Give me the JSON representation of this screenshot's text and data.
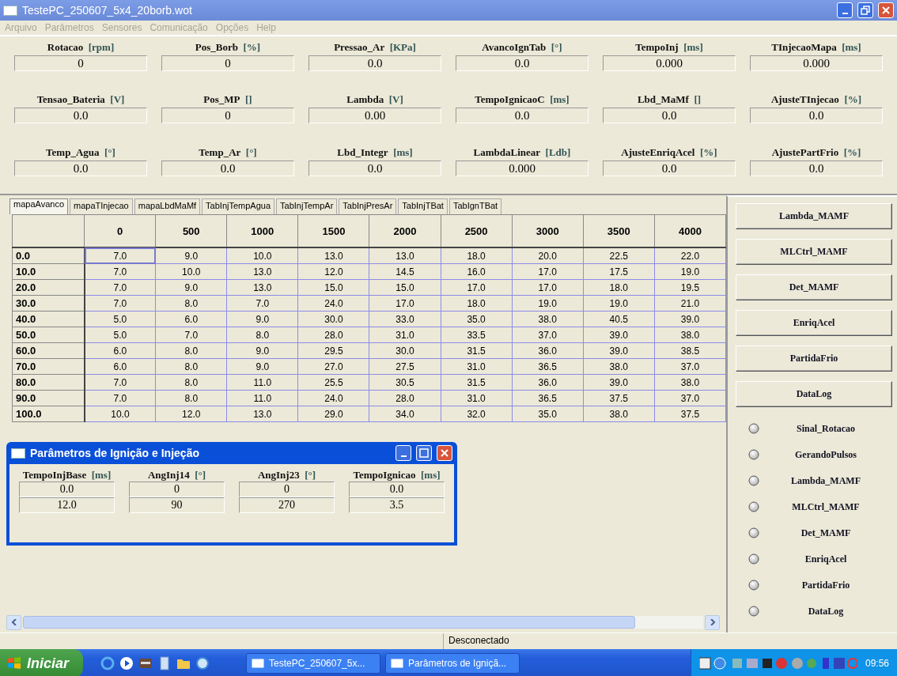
{
  "window": {
    "title": "TestePC_250607_5x4_20borb.wot"
  },
  "menu": [
    {
      "label": "Arquivo",
      "disabled": true
    },
    {
      "label": "Parâmetros",
      "disabled": true
    },
    {
      "label": "Sensores",
      "disabled": true
    },
    {
      "label": "Comunicação",
      "disabled": true
    },
    {
      "label": "Opções",
      "disabled": true
    },
    {
      "label": "Help",
      "disabled": true
    }
  ],
  "gauges": [
    {
      "name": "Rotacao",
      "unit": "[rpm]",
      "value": "0"
    },
    {
      "name": "Pos_Borb",
      "unit": "[%]",
      "value": "0"
    },
    {
      "name": "Pressao_Ar",
      "unit": "[KPa]",
      "value": "0.0"
    },
    {
      "name": "AvancoIgnTab",
      "unit": "[°]",
      "value": "0.0"
    },
    {
      "name": "TempoInj",
      "unit": "[ms]",
      "value": "0.000"
    },
    {
      "name": "TInjecaoMapa",
      "unit": "[ms]",
      "value": "0.000"
    },
    {
      "name": "Tensao_Bateria",
      "unit": "[V]",
      "value": "0.0"
    },
    {
      "name": "Pos_MP",
      "unit": "[]",
      "value": "0"
    },
    {
      "name": "Lambda",
      "unit": "[V]",
      "value": "0.00"
    },
    {
      "name": "TempoIgnicaoC",
      "unit": "[ms]",
      "value": "0.0"
    },
    {
      "name": "Lbd_MaMf",
      "unit": "[]",
      "value": "0.0"
    },
    {
      "name": "AjusteTInjecao",
      "unit": "[%]",
      "value": "0.0"
    },
    {
      "name": "Temp_Agua",
      "unit": "[°]",
      "value": "0.0"
    },
    {
      "name": "Temp_Ar",
      "unit": "[°]",
      "value": "0.0"
    },
    {
      "name": "Lbd_Integr",
      "unit": "[ms]",
      "value": "0.0"
    },
    {
      "name": "LambdaLinear",
      "unit": "[Ldb]",
      "value": "0.000"
    },
    {
      "name": "AjusteEnriqAcel",
      "unit": "[%]",
      "value": "0.0"
    },
    {
      "name": "AjustePartFrio",
      "unit": "[%]",
      "value": "0.0"
    }
  ],
  "tabs": [
    {
      "label": "mapaAvanco",
      "selected": true
    },
    {
      "label": "mapaTInjecao",
      "selected": false
    },
    {
      "label": "mapaLbdMaMf",
      "selected": false
    },
    {
      "label": "TabInjTempAgua",
      "selected": false
    },
    {
      "label": "TabInjTempAr",
      "selected": false
    },
    {
      "label": "TabInjPresAr",
      "selected": false
    },
    {
      "label": "TabInjTBat",
      "selected": false
    },
    {
      "label": "TabIgnTBat",
      "selected": false
    }
  ],
  "table": {
    "columns": [
      "0",
      "500",
      "1000",
      "1500",
      "2000",
      "2500",
      "3000",
      "3500",
      "4000"
    ],
    "rows": [
      {
        "label": "0.0",
        "cells": [
          {
            "value": "7.0",
            "selected": true
          },
          {
            "value": "9.0",
            "selected": false
          },
          {
            "value": "10.0",
            "selected": false
          },
          {
            "value": "13.0",
            "selected": false
          },
          {
            "value": "13.0",
            "selected": false
          },
          {
            "value": "18.0",
            "selected": false
          },
          {
            "value": "20.0",
            "selected": false
          },
          {
            "value": "22.5",
            "selected": false
          },
          {
            "value": "22.0",
            "selected": false
          }
        ]
      },
      {
        "label": "10.0",
        "cells": [
          {
            "value": "7.0",
            "selected": false
          },
          {
            "value": "10.0",
            "selected": false
          },
          {
            "value": "13.0",
            "selected": false
          },
          {
            "value": "12.0",
            "selected": false
          },
          {
            "value": "14.5",
            "selected": false
          },
          {
            "value": "16.0",
            "selected": false
          },
          {
            "value": "17.0",
            "selected": false
          },
          {
            "value": "17.5",
            "selected": false
          },
          {
            "value": "19.0",
            "selected": false
          }
        ]
      },
      {
        "label": "20.0",
        "cells": [
          {
            "value": "7.0",
            "selected": false
          },
          {
            "value": "9.0",
            "selected": false
          },
          {
            "value": "13.0",
            "selected": false
          },
          {
            "value": "15.0",
            "selected": false
          },
          {
            "value": "15.0",
            "selected": false
          },
          {
            "value": "17.0",
            "selected": false
          },
          {
            "value": "17.0",
            "selected": false
          },
          {
            "value": "18.0",
            "selected": false
          },
          {
            "value": "19.5",
            "selected": false
          }
        ]
      },
      {
        "label": "30.0",
        "cells": [
          {
            "value": "7.0",
            "selected": false
          },
          {
            "value": "8.0",
            "selected": false
          },
          {
            "value": "7.0",
            "selected": false
          },
          {
            "value": "24.0",
            "selected": false
          },
          {
            "value": "17.0",
            "selected": false
          },
          {
            "value": "18.0",
            "selected": false
          },
          {
            "value": "19.0",
            "selected": false
          },
          {
            "value": "19.0",
            "selected": false
          },
          {
            "value": "21.0",
            "selected": false
          }
        ]
      },
      {
        "label": "40.0",
        "cells": [
          {
            "value": "5.0",
            "selected": false
          },
          {
            "value": "6.0",
            "selected": false
          },
          {
            "value": "9.0",
            "selected": false
          },
          {
            "value": "30.0",
            "selected": false
          },
          {
            "value": "33.0",
            "selected": false
          },
          {
            "value": "35.0",
            "selected": false
          },
          {
            "value": "38.0",
            "selected": false
          },
          {
            "value": "40.5",
            "selected": false
          },
          {
            "value": "39.0",
            "selected": false
          }
        ]
      },
      {
        "label": "50.0",
        "cells": [
          {
            "value": "5.0",
            "selected": false
          },
          {
            "value": "7.0",
            "selected": false
          },
          {
            "value": "8.0",
            "selected": false
          },
          {
            "value": "28.0",
            "selected": false
          },
          {
            "value": "31.0",
            "selected": false
          },
          {
            "value": "33.5",
            "selected": false
          },
          {
            "value": "37.0",
            "selected": false
          },
          {
            "value": "39.0",
            "selected": false
          },
          {
            "value": "38.0",
            "selected": false
          }
        ]
      },
      {
        "label": "60.0",
        "cells": [
          {
            "value": "6.0",
            "selected": false
          },
          {
            "value": "8.0",
            "selected": false
          },
          {
            "value": "9.0",
            "selected": false
          },
          {
            "value": "29.5",
            "selected": false
          },
          {
            "value": "30.0",
            "selected": false
          },
          {
            "value": "31.5",
            "selected": false
          },
          {
            "value": "36.0",
            "selected": false
          },
          {
            "value": "39.0",
            "selected": false
          },
          {
            "value": "38.5",
            "selected": false
          }
        ]
      },
      {
        "label": "70.0",
        "cells": [
          {
            "value": "6.0",
            "selected": false
          },
          {
            "value": "8.0",
            "selected": false
          },
          {
            "value": "9.0",
            "selected": false
          },
          {
            "value": "27.0",
            "selected": false
          },
          {
            "value": "27.5",
            "selected": false
          },
          {
            "value": "31.0",
            "selected": false
          },
          {
            "value": "36.5",
            "selected": false
          },
          {
            "value": "38.0",
            "selected": false
          },
          {
            "value": "37.0",
            "selected": false
          }
        ]
      },
      {
        "label": "80.0",
        "cells": [
          {
            "value": "7.0",
            "selected": false
          },
          {
            "value": "8.0",
            "selected": false
          },
          {
            "value": "11.0",
            "selected": false
          },
          {
            "value": "25.5",
            "selected": false
          },
          {
            "value": "30.5",
            "selected": false
          },
          {
            "value": "31.5",
            "selected": false
          },
          {
            "value": "36.0",
            "selected": false
          },
          {
            "value": "39.0",
            "selected": false
          },
          {
            "value": "38.0",
            "selected": false
          }
        ]
      },
      {
        "label": "90.0",
        "cells": [
          {
            "value": "7.0",
            "selected": false
          },
          {
            "value": "8.0",
            "selected": false
          },
          {
            "value": "11.0",
            "selected": false
          },
          {
            "value": "24.0",
            "selected": false
          },
          {
            "value": "28.0",
            "selected": false
          },
          {
            "value": "31.0",
            "selected": false
          },
          {
            "value": "36.5",
            "selected": false
          },
          {
            "value": "37.5",
            "selected": false
          },
          {
            "value": "37.0",
            "selected": false
          }
        ]
      },
      {
        "label": "100.0",
        "cells": [
          {
            "value": "10.0",
            "selected": false
          },
          {
            "value": "12.0",
            "selected": false
          },
          {
            "value": "13.0",
            "selected": false
          },
          {
            "value": "29.0",
            "selected": false
          },
          {
            "value": "34.0",
            "selected": false
          },
          {
            "value": "32.0",
            "selected": false
          },
          {
            "value": "35.0",
            "selected": false
          },
          {
            "value": "38.0",
            "selected": false
          },
          {
            "value": "37.5",
            "selected": false
          }
        ]
      }
    ]
  },
  "dialog": {
    "title": "Parâmetros de Ignição e Injeção",
    "fields": [
      {
        "name": "TempoInjBase",
        "unit": "[ms]",
        "values": [
          "0.0",
          "12.0"
        ]
      },
      {
        "name": "AngInj14",
        "unit": "[°]",
        "values": [
          "0",
          "90"
        ]
      },
      {
        "name": "AngInj23",
        "unit": "[°]",
        "values": [
          "0",
          "270"
        ]
      },
      {
        "name": "TempoIgnicao",
        "unit": "[ms]",
        "values": [
          "0.0",
          "3.5"
        ]
      }
    ]
  },
  "side_buttons": [
    "Lambda_MAMF",
    "MLCtrl_MAMF",
    "Det_MAMF",
    "EnriqAcel",
    "PartidaFrio",
    "DataLog"
  ],
  "indicators": [
    {
      "label": "Sinal_Rotacao",
      "on": false
    },
    {
      "label": "GerandoPulsos",
      "on": false
    },
    {
      "label": "Lambda_MAMF",
      "on": false
    },
    {
      "label": "MLCtrl_MAMF",
      "on": false
    },
    {
      "label": "Det_MAMF",
      "on": false
    },
    {
      "label": "EnriqAcel",
      "on": false
    },
    {
      "label": "PartidaFrio",
      "on": false
    },
    {
      "label": "DataLog",
      "on": false
    }
  ],
  "status_bar": "Desconectado",
  "taskbar": {
    "start": "Iniciar",
    "tasks": [
      "TestePC_250607_5x...",
      "Parâmetros de Igniçã..."
    ],
    "clock": "09:56"
  }
}
